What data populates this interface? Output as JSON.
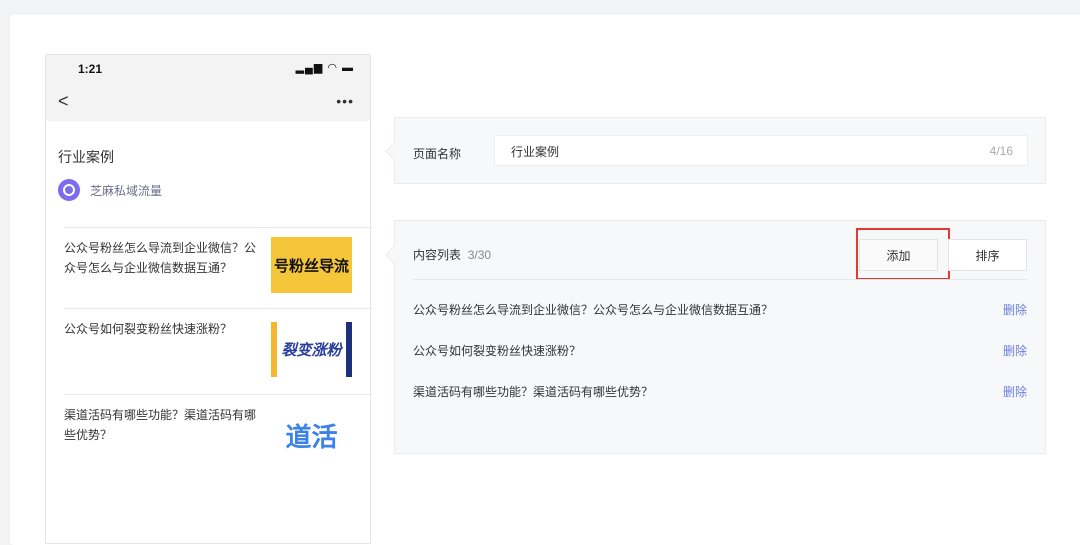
{
  "phone": {
    "time": "1:21",
    "status_icons": "signal wifi battery",
    "title": "行业案例",
    "author": "芝麻私域流量",
    "articles": [
      {
        "title": "公众号粉丝怎么导流到企业微信？公众号怎么与企业微信数据互通？",
        "thumb": "号粉丝导流"
      },
      {
        "title": "公众号如何裂变粉丝快速涨粉？",
        "thumb": "裂变涨粉"
      },
      {
        "title": "渠道活码有哪些功能？渠道活码有哪些优势？",
        "thumb": "道活"
      }
    ]
  },
  "page_name": {
    "label": "页面名称",
    "value": "行业案例",
    "count": "4/16"
  },
  "content_list": {
    "label": "内容列表",
    "count": "3/30",
    "add_label": "添加",
    "sort_label": "排序",
    "delete_label": "删除",
    "items": [
      "公众号粉丝怎么导流到企业微信？公众号怎么与企业微信数据互通？",
      "公众号如何裂变粉丝快速涨粉？",
      "渠道活码有哪些功能？渠道活码有哪些优势？"
    ]
  }
}
